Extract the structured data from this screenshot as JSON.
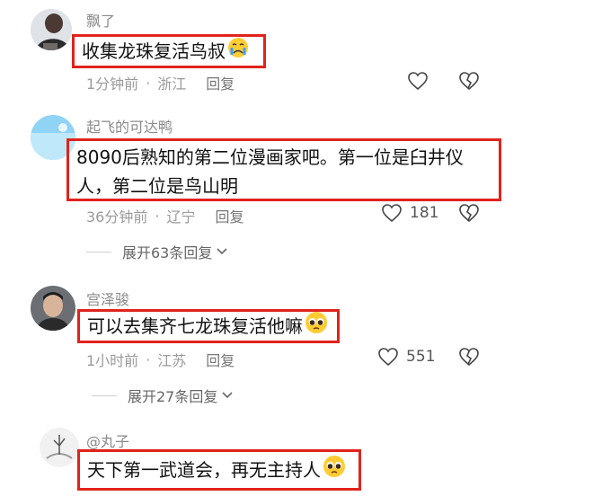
{
  "comments": [
    {
      "user": "飘了",
      "text": "收集龙珠复活鸟叔",
      "emoji": "crying-face-emoji",
      "time": "1分钟前",
      "location": "浙江",
      "reply": "回复",
      "likes": ""
    },
    {
      "user": "起飞的可达鸭",
      "line1": "8090后熟知的第二位漫画家吧。第一位是臼井仪",
      "line2": "人，第二位是鸟山明",
      "time": "36分钟前",
      "location": "辽宁",
      "reply": "回复",
      "likes": "181",
      "expand": "展开63条回复"
    },
    {
      "user": "宫泽骏",
      "text": "可以去集齐七龙珠复活他嘛",
      "emoji": "pleading-face-emoji",
      "time": "1小时前",
      "location": "江苏",
      "reply": "回复",
      "likes": "551",
      "expand": "展开27条回复"
    },
    {
      "user": "@丸子",
      "text": "天下第一武道会，再无主持人",
      "emoji": "pleading-face-emoji"
    }
  ],
  "separator": "·",
  "colors": {
    "highlight_border": "#e0231c",
    "meta_text": "#9a9a9a"
  }
}
